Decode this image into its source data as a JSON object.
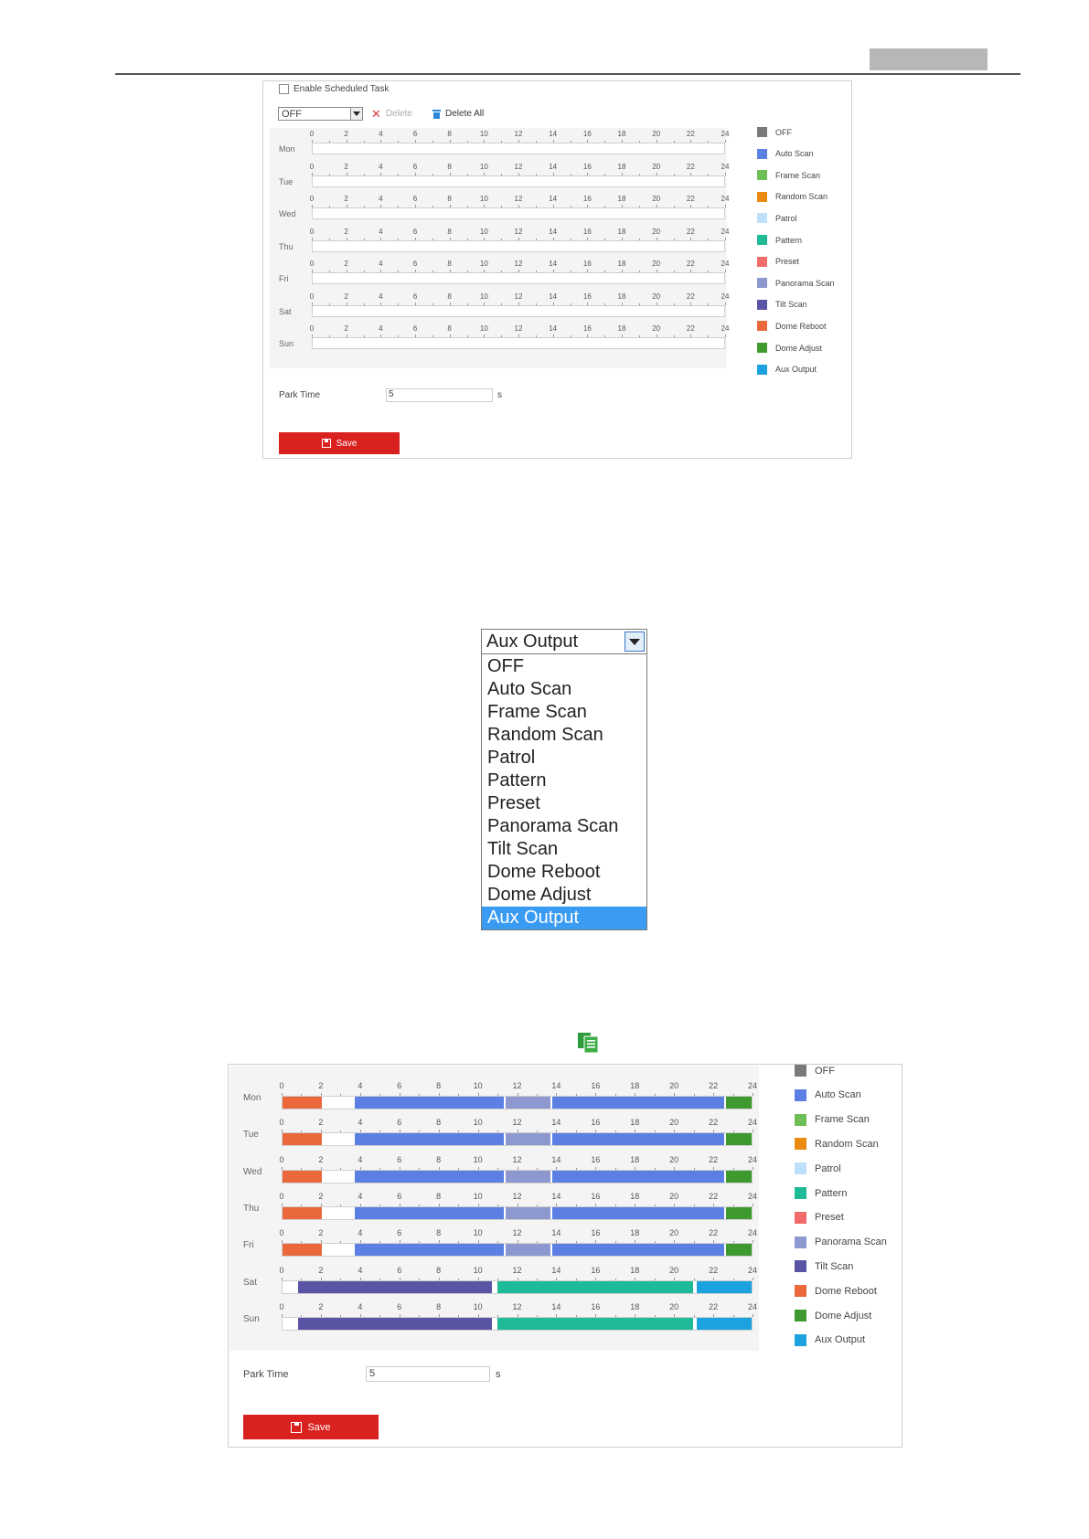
{
  "colors": {
    "OFF": "#7a7a7a",
    "Auto Scan": "#5b7fe2",
    "Frame Scan": "#6fbe58",
    "Random Scan": "#ea8a10",
    "Patrol": "#bfe0fb",
    "Pattern": "#1fbb98",
    "Preset": "#f26b6b",
    "Panorama Scan": "#8c98cf",
    "Tilt Scan": "#5a54a4",
    "Dome Reboot": "#ea683c",
    "Dome Adjust": "#3e9a2e",
    "Aux Output": "#1ca2de"
  },
  "legend": [
    "OFF",
    "Auto Scan",
    "Frame Scan",
    "Random Scan",
    "Patrol",
    "Pattern",
    "Preset",
    "Panorama Scan",
    "Tilt Scan",
    "Dome Reboot",
    "Dome Adjust",
    "Aux Output"
  ],
  "days": [
    "Mon",
    "Tue",
    "Wed",
    "Thu",
    "Fri",
    "Sat",
    "Sun"
  ],
  "hours": [
    "0",
    "2",
    "4",
    "6",
    "8",
    "10",
    "12",
    "14",
    "16",
    "18",
    "20",
    "22",
    "24"
  ],
  "top": {
    "enable_label": "Enable Scheduled Task",
    "select_value": "OFF",
    "delete_label": "Delete",
    "delete_all_label": "Delete All",
    "park_label": "Park Time",
    "park_value": "5",
    "park_unit": "s",
    "save_label": "Save"
  },
  "dropdown": {
    "value": "Aux Output",
    "options": [
      "OFF",
      "Auto Scan",
      "Frame Scan",
      "Random Scan",
      "Patrol",
      "Pattern",
      "Preset",
      "Panorama Scan",
      "Tilt Scan",
      "Dome Reboot",
      "Dome Adjust",
      "Aux Output"
    ],
    "selected": "Aux Output"
  },
  "bottom": {
    "park_label": "Park Time",
    "park_value": "5",
    "park_unit": "s",
    "save_label": "Save",
    "schedule": {
      "Mon": [
        [
          0,
          2,
          "Dome Reboot"
        ],
        [
          3.7,
          11.3,
          "Auto Scan"
        ],
        [
          11.4,
          13.7,
          "Panorama Scan"
        ],
        [
          13.8,
          22.6,
          "Auto Scan"
        ],
        [
          22.7,
          24,
          "Dome Adjust"
        ]
      ],
      "Tue": [
        [
          0,
          2,
          "Dome Reboot"
        ],
        [
          3.7,
          11.3,
          "Auto Scan"
        ],
        [
          11.4,
          13.7,
          "Panorama Scan"
        ],
        [
          13.8,
          22.6,
          "Auto Scan"
        ],
        [
          22.7,
          24,
          "Dome Adjust"
        ]
      ],
      "Wed": [
        [
          0,
          2,
          "Dome Reboot"
        ],
        [
          3.7,
          11.3,
          "Auto Scan"
        ],
        [
          11.4,
          13.7,
          "Panorama Scan"
        ],
        [
          13.8,
          22.6,
          "Auto Scan"
        ],
        [
          22.7,
          24,
          "Dome Adjust"
        ]
      ],
      "Thu": [
        [
          0,
          2,
          "Dome Reboot"
        ],
        [
          3.7,
          11.3,
          "Auto Scan"
        ],
        [
          11.4,
          13.7,
          "Panorama Scan"
        ],
        [
          13.8,
          22.6,
          "Auto Scan"
        ],
        [
          22.7,
          24,
          "Dome Adjust"
        ]
      ],
      "Fri": [
        [
          0,
          2,
          "Dome Reboot"
        ],
        [
          3.7,
          11.3,
          "Auto Scan"
        ],
        [
          11.4,
          13.7,
          "Panorama Scan"
        ],
        [
          13.8,
          22.6,
          "Auto Scan"
        ],
        [
          22.7,
          24,
          "Dome Adjust"
        ]
      ],
      "Sat": [
        [
          0.8,
          10.7,
          "Tilt Scan"
        ],
        [
          11,
          21,
          "Pattern"
        ],
        [
          21.2,
          24,
          "Aux Output"
        ]
      ],
      "Sun": [
        [
          0.8,
          10.7,
          "Tilt Scan"
        ],
        [
          11,
          21,
          "Pattern"
        ],
        [
          21.2,
          24,
          "Aux Output"
        ]
      ]
    }
  }
}
